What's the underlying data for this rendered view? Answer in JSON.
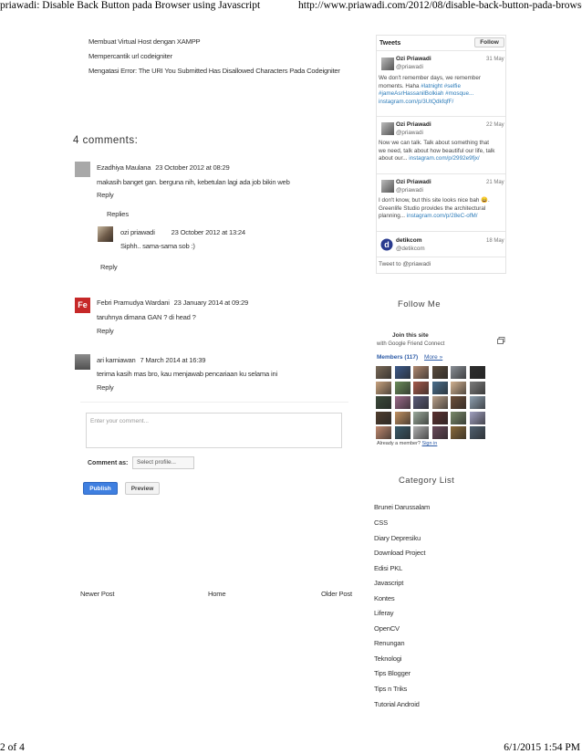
{
  "print_header": {
    "title": "priawadi: Disable Back Button pada Browser using Javascript",
    "url": "http://www.priawadi.com/2012/08/disable-back-button-pada-browser-usi..."
  },
  "print_footer": {
    "page": "2 of 4",
    "datetime": "6/1/2015 1:54 PM"
  },
  "related_posts": [
    "Membuat Virtual Host dengan XAMPP",
    "Mempercantik url codeigniter",
    "Mengatasi Error: The URI You Submitted Has Disallowed Characters Pada Codeigniter"
  ],
  "comments": {
    "title": "4 comments:",
    "items": [
      {
        "author": "Ezadhiya Maulana",
        "date": "23 October 2012 at 08:29",
        "text": "makasih banget gan. berguna nih, kebetulan lagi ada job bikin web",
        "reply": "Reply"
      },
      {
        "author": "Febri Pramudya Wardani",
        "date": "23 January 2014 at 09:29",
        "text": "taruhnya dimana GAN ? di head ?",
        "reply": "Reply",
        "avatar_text": "Fe"
      },
      {
        "author": "ari karniawan",
        "date": "7 March 2014 at 16:39",
        "text": "terima kasih mas bro, kau menjawab pencariaan ku selama ini",
        "reply": "Reply"
      }
    ],
    "replies_label": "Replies",
    "nested": {
      "author": "ozi priawadi",
      "date": "23 October 2012 at 13:24",
      "text": "Siphh.. sama-sama sob :)"
    },
    "thread_reply": "Reply"
  },
  "comment_form": {
    "placeholder": "Enter your comment...",
    "comment_as_label": "Comment as:",
    "profile_select": "Select profile...",
    "publish": "Publish",
    "preview": "Preview"
  },
  "pager": {
    "newer": "Newer Post",
    "home": "Home",
    "older": "Older Post"
  },
  "tweets": {
    "header": "Tweets",
    "follow": "Follow",
    "items": [
      {
        "name": "Ozi Priawadi",
        "handle": "@priawadi",
        "time": "31 May",
        "lines": [
          "We don't remember days, we remember",
          "moments. Haha"
        ],
        "link_inline": "#latnight #selfie",
        "link_lines": [
          "#jameAsrHassanilBolkiah #mosque...",
          "instagram.com/p/3UtQdkfqfF/"
        ]
      },
      {
        "name": "Ozi Priawadi",
        "handle": "@priawadi",
        "time": "22 May",
        "lines": [
          "Now we can talk. Talk about something that",
          "we need, talk about how beautiful our life, talk",
          "about our..."
        ],
        "link_inline": "instagram.com/p/2992e9fjx/"
      },
      {
        "name": "Ozi Priawadi",
        "handle": "@priawadi",
        "time": "21 May",
        "lines": [
          "I don't know, but this site looks nice bah 😄.",
          "Greenlife Studio provides the architectural",
          "planning..."
        ],
        "link_inline": "instagram.com/p/28eC-ofM/"
      },
      {
        "name": "detikcom",
        "handle": "@detikcom",
        "time": "18 May"
      }
    ],
    "compose": "Tweet to @priawadi"
  },
  "follow_me": {
    "title": "Follow Me",
    "join": "Join this site",
    "sub": "with Google Friend Connect",
    "members": "Members (117)",
    "more": "More »",
    "already": "Already a member?",
    "sign_in": "Sign in",
    "member_colors": [
      "#7a6a58",
      "#3d5a8a",
      "#b08970",
      "#5a4b3c",
      "#8a8f96",
      "#2e2e2e",
      "#c7a27e",
      "#6b8c5a",
      "#a55a4b",
      "#4a6e8c",
      "#d0b090",
      "#7d7d7d",
      "#3b4a3a",
      "#9c6b8a",
      "#5c5c7a",
      "#b9a08a",
      "#6e4f3a",
      "#8fa0b0",
      "#4f3d2e",
      "#c09060",
      "#9aa89a",
      "#5a3030",
      "#7a8a6a",
      "#a0a0c0",
      "#c08a70",
      "#3a5a6a",
      "#b0b0b0",
      "#6a4a5a",
      "#8a6a3a",
      "#506070"
    ]
  },
  "category": {
    "title": "Category List",
    "items": [
      "Brunei Darussalam",
      "CSS",
      "Diary Depresiku",
      "Download Project",
      "Edisi PKL",
      "Javascript",
      "Kontes",
      "Liferay",
      "OpenCV",
      "Renungan",
      "Teknologi",
      "Tips Blogger",
      "Tips n Triks",
      "Tutorial Android"
    ]
  }
}
